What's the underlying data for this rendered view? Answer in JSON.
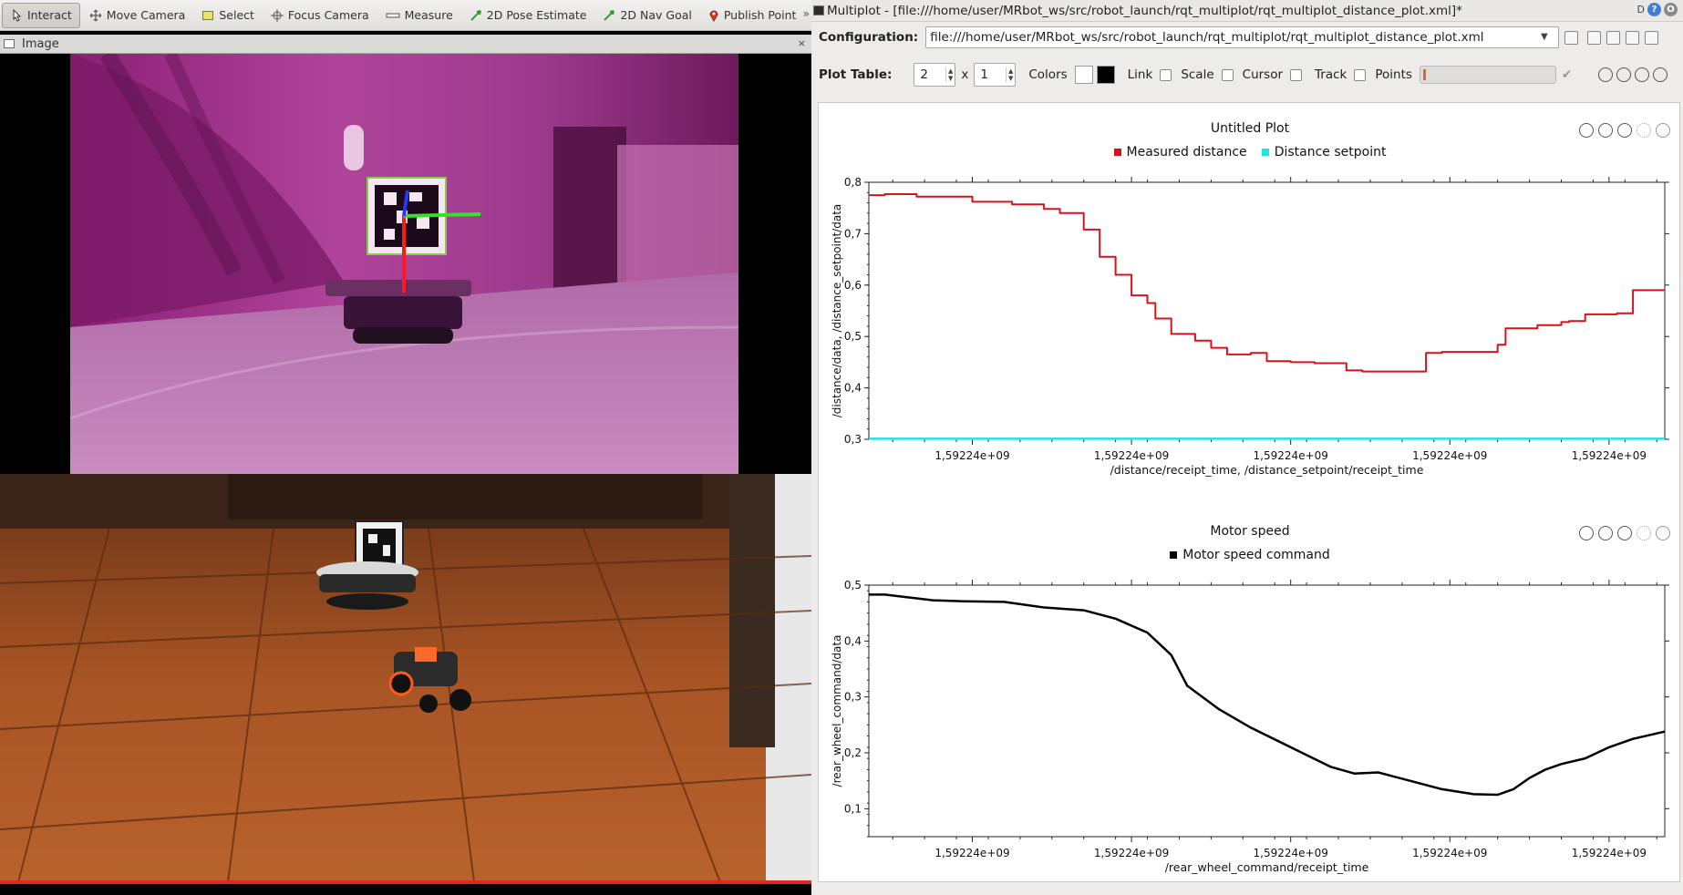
{
  "rviz": {
    "tools": [
      {
        "label": "Interact",
        "icon": "cursor-icon",
        "active": true
      },
      {
        "label": "Move Camera",
        "icon": "move-camera-icon"
      },
      {
        "label": "Select",
        "icon": "select-icon"
      },
      {
        "label": "Focus Camera",
        "icon": "focus-camera-icon"
      },
      {
        "label": "Measure",
        "icon": "measure-icon"
      },
      {
        "label": "2D Pose Estimate",
        "icon": "pose-arrow-icon"
      },
      {
        "label": "2D Nav Goal",
        "icon": "nav-goal-arrow-icon"
      },
      {
        "label": "Publish Point",
        "icon": "map-pin-icon"
      }
    ],
    "more": "»",
    "image_panel_title": "Image",
    "close_glyph": "×"
  },
  "video": {
    "progress": 0.675,
    "progress_color": "#e52521"
  },
  "multiplot": {
    "window_title": "Multiplot - [file:///home/user/MRbot_ws/src/robot_launch/rqt_multiplot/rqt_multiplot_distance_plot.xml]*",
    "title_buttons": [
      "D",
      "?",
      "O"
    ],
    "configuration_label": "Configuration:",
    "configuration_value": "file:///home/user/MRbot_ws/src/robot_launch/rqt_multiplot/rqt_multiplot_distance_plot.xml",
    "plot_table_label": "Plot Table:",
    "rows": "2",
    "x_sep": "x",
    "cols": "1",
    "colors_label": "Colors",
    "link_label": "Link",
    "scale_label": "Scale",
    "cursor_label": "Cursor",
    "track_label": "Track",
    "points_label": "Points"
  },
  "plots": [
    {
      "title": "Untitled Plot",
      "legend": [
        {
          "name": "Measured distance",
          "color": "#d4141c"
        },
        {
          "name": "Distance setpoint",
          "color": "#22e3e3"
        }
      ]
    },
    {
      "title": "Motor speed",
      "legend": [
        {
          "name": "Motor speed command",
          "color": "#000000"
        }
      ]
    }
  ],
  "chart_data": [
    {
      "type": "line",
      "title": "Untitled Plot",
      "xlabel": "/distance/receipt_time, /distance_setpoint/receipt_time",
      "ylabel": "/distance/data, /distance_setpoint/data",
      "ylim": [
        0.3,
        0.8
      ],
      "xlim": [
        0,
        100
      ],
      "yticks": [
        "0,3",
        "0,4",
        "0,5",
        "0,6",
        "0,7",
        "0,8"
      ],
      "yticks_values": [
        0.3,
        0.4,
        0.5,
        0.6,
        0.7,
        0.8
      ],
      "xtick_labels": [
        "1,59224e+09",
        "1,59224e+09",
        "1,59224e+09",
        "1,59224e+09",
        "1,59224e+09"
      ],
      "xtick_positions": [
        13,
        33,
        53,
        73,
        93
      ],
      "grid": false,
      "legend_position": "top",
      "series": [
        {
          "name": "Measured distance",
          "color": "#d4141c",
          "step": true,
          "x": [
            0,
            2,
            6,
            13,
            18,
            22,
            24,
            27,
            29,
            31,
            33,
            35,
            36,
            38,
            41,
            43,
            45,
            48,
            50,
            53,
            56,
            60,
            62,
            65,
            70,
            72,
            79,
            80,
            84,
            87,
            88,
            90,
            94,
            96,
            99,
            100
          ],
          "y": [
            0.775,
            0.777,
            0.772,
            0.762,
            0.757,
            0.748,
            0.74,
            0.708,
            0.655,
            0.62,
            0.58,
            0.565,
            0.535,
            0.505,
            0.492,
            0.478,
            0.465,
            0.468,
            0.452,
            0.45,
            0.448,
            0.434,
            0.432,
            0.432,
            0.468,
            0.47,
            0.484,
            0.516,
            0.522,
            0.528,
            0.53,
            0.543,
            0.545,
            0.59,
            0.59,
            0.59
          ]
        },
        {
          "name": "Distance setpoint",
          "color": "#22e3e3",
          "step": false,
          "x": [
            0,
            100
          ],
          "y": [
            0.301,
            0.301
          ]
        }
      ]
    },
    {
      "type": "line",
      "title": "Motor speed",
      "xlabel": "/rear_wheel_command/receipt_time",
      "ylabel": "/rear_wheel_command/data",
      "ylim": [
        0.05,
        0.5
      ],
      "xlim": [
        0,
        100
      ],
      "yticks": [
        "0,1",
        "0,2",
        "0,3",
        "0,4",
        "0,5"
      ],
      "yticks_values": [
        0.1,
        0.2,
        0.3,
        0.4,
        0.5
      ],
      "xtick_labels": [
        "1,59224e+09",
        "1,59224e+09",
        "1,59224e+09",
        "1,59224e+09",
        "1,59224e+09"
      ],
      "xtick_positions": [
        13,
        33,
        53,
        73,
        93
      ],
      "grid": false,
      "legend_position": "top",
      "series": [
        {
          "name": "Motor speed command",
          "color": "#000000",
          "step": false,
          "x": [
            0,
            2,
            5,
            8,
            12,
            17,
            22,
            27,
            31,
            35,
            38,
            40,
            44,
            48,
            53,
            58,
            61,
            64,
            68,
            72,
            76,
            79,
            81,
            83,
            85,
            87,
            90,
            93,
            96,
            100
          ],
          "y": [
            0.483,
            0.483,
            0.478,
            0.473,
            0.471,
            0.47,
            0.46,
            0.455,
            0.44,
            0.415,
            0.375,
            0.32,
            0.278,
            0.245,
            0.21,
            0.175,
            0.163,
            0.165,
            0.15,
            0.135,
            0.126,
            0.125,
            0.135,
            0.155,
            0.17,
            0.18,
            0.19,
            0.21,
            0.225,
            0.238
          ]
        }
      ]
    }
  ]
}
